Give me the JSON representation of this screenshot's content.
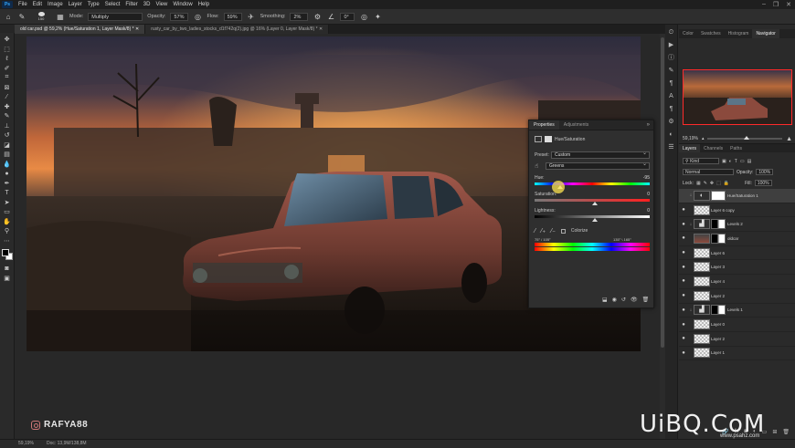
{
  "menubar": {
    "logo": "Ps",
    "items": [
      "File",
      "Edit",
      "Image",
      "Layer",
      "Type",
      "Select",
      "Filter",
      "3D",
      "View",
      "Window",
      "Help"
    ],
    "window_controls": [
      "–",
      "❐",
      "✕"
    ]
  },
  "options": {
    "brush_size": "150",
    "mode_label": "Mode:",
    "mode_value": "Multiply",
    "opacity_label": "Opacity:",
    "opacity_value": "57%",
    "flow_label": "Flow:",
    "flow_value": "59%",
    "smoothing_label": "Smoothing:",
    "smoothing_value": "2%",
    "angle_value": "0°"
  },
  "tabs": [
    {
      "label": "old car.psd @ 59,2% (Hue/Saturation 1, Layer Mask/8) *",
      "active": true
    },
    {
      "label": "rusty_car_by_two_ladies_stocks_d1f742q(2).jpg @ 16% (Layer 0, Layer Mask/8) *",
      "active": false
    }
  ],
  "properties": {
    "tabs": [
      "Properties",
      "Adjustments"
    ],
    "close": "»",
    "header": "Hue/Saturation",
    "preset_label": "Preset:",
    "preset_value": "Custom",
    "channel_value": "Greens",
    "hue_label": "Hue:",
    "hue_value": "-95",
    "hue_fraction": 0.2,
    "saturation_label": "Saturation:",
    "saturation_value": "0",
    "saturation_fraction": 0.5,
    "lightness_label": "Lightness:",
    "lightness_value": "0",
    "lightness_fraction": 0.5,
    "colorize_label": "Colorize",
    "range_left": "75° / 105°",
    "range_right": "135° \\ 165°"
  },
  "navigator": {
    "tabs": [
      "Color",
      "Swatches",
      "Histogram",
      "Navigator"
    ],
    "zoom": "59,19%"
  },
  "layers_panel": {
    "tabs": [
      "Layers",
      "Channels",
      "Paths"
    ],
    "kind_label": "Kind",
    "blend_mode": "Normal",
    "opacity_label": "Opacity:",
    "opacity_value": "100%",
    "lock_label": "Lock:",
    "fill_label": "Fill:",
    "fill_value": "100%",
    "layers": [
      {
        "name": "Hue/Saturation 1",
        "visible": false,
        "selected": true,
        "type": "adjust"
      },
      {
        "name": "Layer 6 copy",
        "visible": true,
        "selected": false,
        "type": "pixel"
      },
      {
        "name": "Levels 2",
        "visible": true,
        "selected": false,
        "type": "levels"
      },
      {
        "name": "oldcar",
        "visible": true,
        "selected": false,
        "type": "car"
      },
      {
        "name": "Layer 6",
        "visible": true,
        "selected": false,
        "type": "pixel"
      },
      {
        "name": "Layer 3",
        "visible": true,
        "selected": false,
        "type": "pixel"
      },
      {
        "name": "Layer 4",
        "visible": true,
        "selected": false,
        "type": "pixel"
      },
      {
        "name": "Layer 2",
        "visible": true,
        "selected": false,
        "type": "pixel"
      },
      {
        "name": "Levels 1",
        "visible": true,
        "selected": false,
        "type": "levels"
      },
      {
        "name": "Layer 0",
        "visible": true,
        "selected": false,
        "type": "pixel"
      },
      {
        "name": "Layer 2",
        "visible": true,
        "selected": false,
        "type": "pixel"
      },
      {
        "name": "Layer 1",
        "visible": true,
        "selected": false,
        "type": "pixel"
      }
    ]
  },
  "status": {
    "zoom": "59,19%",
    "doc": "Doc: 13,9M/138,8M"
  },
  "watermarks": {
    "instagram": "RAFYA88",
    "site": "UiBQ.CoM",
    "site_sub": "www.psahz.com"
  },
  "colors": {
    "accent": "#31a8ff",
    "nav_frame": "#ff2a2a"
  }
}
